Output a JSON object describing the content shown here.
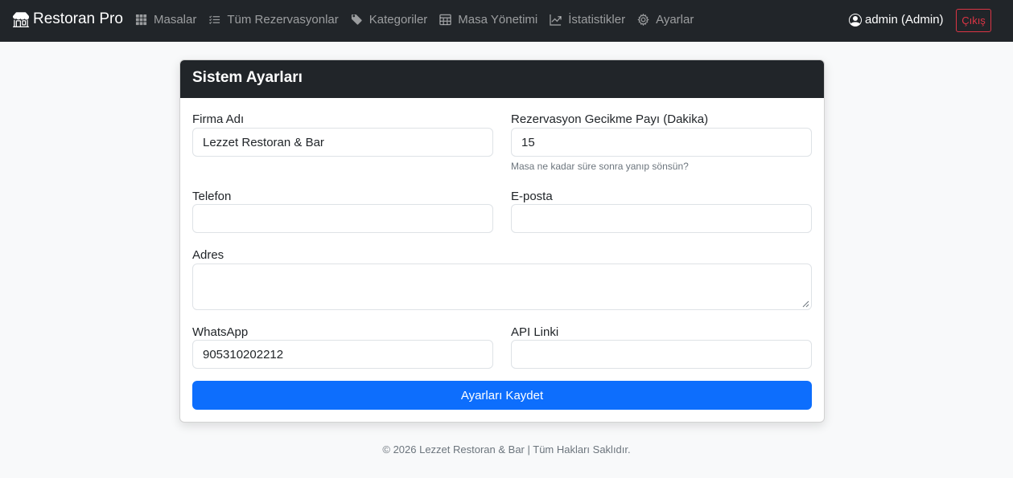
{
  "navbar": {
    "brand": "Restoran Pro",
    "items": [
      {
        "label": "Masalar",
        "icon": "grid-icon"
      },
      {
        "label": "Tüm Rezervasyonlar",
        "icon": "list-icon"
      },
      {
        "label": "Kategoriler",
        "icon": "tag-icon"
      },
      {
        "label": "Masa Yönetimi",
        "icon": "table-icon"
      },
      {
        "label": "İstatistikler",
        "icon": "chart-icon"
      },
      {
        "label": "Ayarlar",
        "icon": "gear-icon"
      }
    ],
    "user": "admin (Admin)",
    "logout": "Çıkış"
  },
  "card": {
    "title": "Sistem Ayarları",
    "fields": {
      "company_name": {
        "label": "Firma Adı",
        "value": "Lezzet Restoran & Bar"
      },
      "delay": {
        "label": "Rezervasyon Gecikme Payı (Dakika)",
        "value": "15",
        "help": "Masa ne kadar süre sonra yanıp sönsün?"
      },
      "phone": {
        "label": "Telefon",
        "value": ""
      },
      "email": {
        "label": "E-posta",
        "value": ""
      },
      "address": {
        "label": "Adres",
        "value": ""
      },
      "whatsapp": {
        "label": "WhatsApp",
        "value": "905310202212"
      },
      "api_link": {
        "label": "API Linki",
        "value": ""
      }
    },
    "submit": "Ayarları Kaydet"
  },
  "footer": "© 2026 Lezzet Restoran & Bar | Tüm Hakları Saklıdır.",
  "colors": {
    "navbar": "#212529",
    "primary": "#0d6efd",
    "danger": "#dc3545",
    "page_bg": "#f8f9fa"
  }
}
